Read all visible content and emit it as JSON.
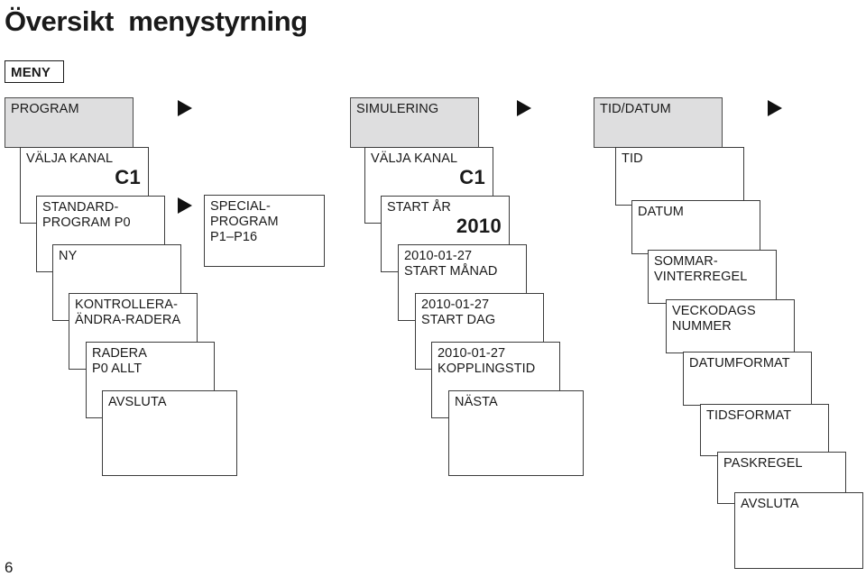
{
  "page": {
    "title": "Översikt  menystyrning",
    "page_number": "6",
    "menu_tag": "MENY"
  },
  "colors": {
    "root_box_fill": "#dededf",
    "box_border": "#3c3c3c",
    "text": "#1a1a1a",
    "arrow": "#111111",
    "background": "#ffffff"
  },
  "arrows": [
    {
      "name": "arrow-program-to-simulering"
    },
    {
      "name": "arrow-simulering-to-tiddatum"
    },
    {
      "name": "arrow-tiddatum-next"
    },
    {
      "name": "arrow-standardprogram-to-specialprogram"
    }
  ],
  "columns": [
    {
      "name": "program",
      "root": "PROGRAM",
      "cards": [
        {
          "line1": "VÄLJA KANAL",
          "line2": "",
          "line3": "",
          "big": "C1"
        },
        {
          "line1": "STANDARD-",
          "line2": "PROGRAM P0",
          "line3": "",
          "big": ""
        },
        {
          "line1": "NY",
          "line2": "",
          "line3": "",
          "big": ""
        },
        {
          "line1": "KONTROLLERA-",
          "line2": "ÄNDRA-RADERA",
          "line3": "",
          "big": ""
        },
        {
          "line1": "RADERA",
          "line2": "P0 ALLT",
          "line3": "",
          "big": ""
        },
        {
          "line1": "AVSLUTA",
          "line2": "",
          "line3": "",
          "big": ""
        }
      ]
    },
    {
      "name": "simulering",
      "root": "SIMULERING",
      "cards": [
        {
          "line1": "VÄLJA KANAL",
          "line2": "",
          "line3": "",
          "big": "C1"
        },
        {
          "line1": "START ÅR",
          "line2": "",
          "line3": "",
          "big": "2010"
        },
        {
          "line1": "2010-01-27",
          "line2": "START MÅNAD",
          "line3": "",
          "big": ""
        },
        {
          "line1": "2010-01-27",
          "line2": "START DAG",
          "line3": "",
          "big": ""
        },
        {
          "line1": "2010-01-27",
          "line2": "KOPPLINGSTID",
          "line3": "",
          "big": ""
        },
        {
          "line1": "NÄSTA",
          "line2": "",
          "line3": "",
          "big": ""
        }
      ]
    },
    {
      "name": "tid-datum",
      "root": "TID/DATUM",
      "cards": [
        {
          "line1": "TID",
          "line2": "",
          "line3": "",
          "big": ""
        },
        {
          "line1": "DATUM",
          "line2": "",
          "line3": "",
          "big": ""
        },
        {
          "line1": "SOMMAR-",
          "line2": "VINTERREGEL",
          "line3": "",
          "big": ""
        },
        {
          "line1": "VECKODAGS",
          "line2": "NUMMER",
          "line3": "",
          "big": ""
        },
        {
          "line1": "DATUMFORMAT",
          "line2": "",
          "line3": "",
          "big": ""
        },
        {
          "line1": "TIDSFORMAT",
          "line2": "",
          "line3": "",
          "big": ""
        },
        {
          "line1": "PASKREGEL",
          "line2": "",
          "line3": "",
          "big": ""
        },
        {
          "line1": "AVSLUTA",
          "line2": "",
          "line3": "",
          "big": ""
        }
      ]
    }
  ],
  "branch": {
    "name": "specialprogram",
    "line1": "SPECIAL-",
    "line2": "PROGRAM",
    "line3": "P1–P16"
  }
}
